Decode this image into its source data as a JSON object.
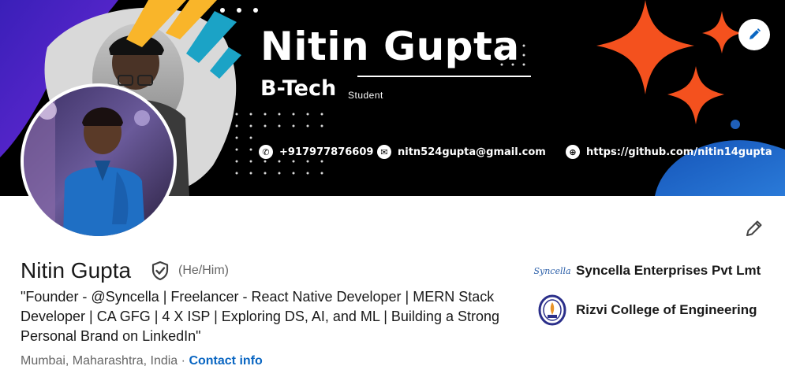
{
  "banner": {
    "name": "Nitin Gupta",
    "degree": "B-Tech",
    "role": "Student",
    "phone": "+917977876609",
    "email": "nitn524gupta@gmail.com",
    "website": "https://github.com/nitin14gupta"
  },
  "profile": {
    "name": "Nitin Gupta",
    "pronouns": "(He/Him)",
    "headline": "\"Founder - @Syncella | Freelancer - React Native Developer | MERN Stack Developer | CA GFG | 4 X ISP | Exploring DS, AI, and ML | Building a Strong Personal Brand on LinkedIn\"",
    "location": "Mumbai, Maharashtra, India",
    "separator": "·",
    "contact_label": "Contact info"
  },
  "organizations": [
    {
      "name": "Syncella Enterprises Pvt Lmt",
      "logo_text": "Syncella"
    },
    {
      "name": "Rizvi College of Engineering"
    }
  ],
  "icons": {
    "edit_banner": "pencil-icon",
    "edit_profile": "pencil-icon",
    "verified": "shield-check-icon",
    "phone": "phone-icon",
    "email": "mail-icon",
    "web": "globe-icon"
  },
  "colors": {
    "link": "#0a66c2",
    "banner_bg": "#000000",
    "star": "#f4511e",
    "accent_yellow": "#f9b52a"
  }
}
